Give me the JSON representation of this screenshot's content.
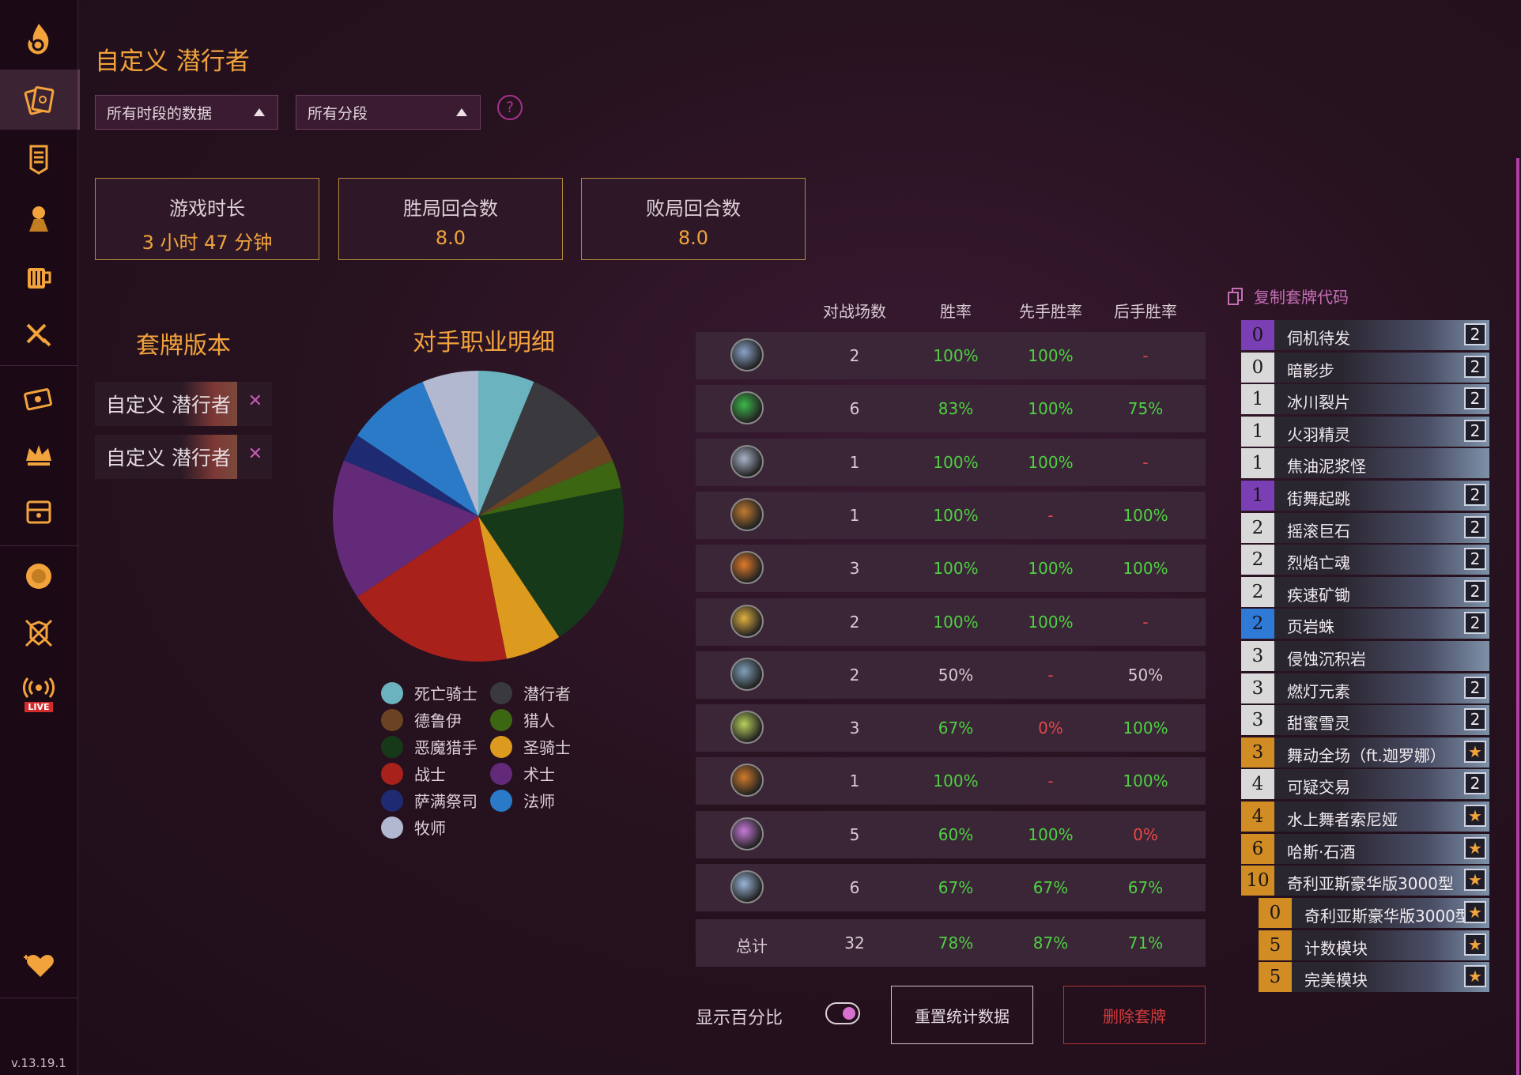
{
  "app": {
    "version": "v.13.19.1"
  },
  "rail": {
    "items": [
      {
        "name": "logo-flame-icon"
      },
      {
        "name": "decks-icon"
      },
      {
        "name": "battlegrounds-icon"
      },
      {
        "name": "mercenaries-icon"
      },
      {
        "name": "tavern-mug-icon"
      },
      {
        "name": "arena-icon"
      },
      {
        "name": "replays-icon"
      },
      {
        "name": "crown-icon"
      },
      {
        "name": "collection-icon"
      },
      {
        "name": "lion-icon"
      },
      {
        "name": "duels-icon"
      },
      {
        "name": "live-stream-icon"
      },
      {
        "name": "support-heart-icon"
      }
    ],
    "live_badge": "LIVE"
  },
  "header": {
    "title": "自定义 潜行者"
  },
  "filters": {
    "time_range": "所有时段的数据",
    "rank": "所有分段",
    "help": "?"
  },
  "stats": [
    {
      "label": "游戏时长",
      "value": "3 小时 47 分钟"
    },
    {
      "label": "胜局回合数",
      "value": "8.0"
    },
    {
      "label": "败局回合数",
      "value": "8.0"
    }
  ],
  "deck_versions": {
    "heading": "套牌版本",
    "items": [
      {
        "label": "自定义 潜行者",
        "close": "✕"
      },
      {
        "label": "自定义 潜行者",
        "close": "✕"
      }
    ]
  },
  "opponents": {
    "heading": "对手职业明细",
    "legend": [
      {
        "name": "死亡骑士",
        "color": "#6bb3be"
      },
      {
        "name": "潜行者",
        "color": "#3a3a3e"
      },
      {
        "name": "德鲁伊",
        "color": "#6b4322"
      },
      {
        "name": "猎人",
        "color": "#3d6612"
      },
      {
        "name": "恶魔猎手",
        "color": "#16391a"
      },
      {
        "name": "圣骑士",
        "color": "#dc9a1e"
      },
      {
        "name": "战士",
        "color": "#a8211a"
      },
      {
        "name": "术士",
        "color": "#622a78"
      },
      {
        "name": "萨满祭司",
        "color": "#1e2a72"
      },
      {
        "name": "法师",
        "color": "#2a7ac8"
      },
      {
        "name": "牧师",
        "color": "#b2b8d0"
      }
    ]
  },
  "chart_data": {
    "type": "pie",
    "labels": [
      "死亡骑士",
      "潜行者",
      "德鲁伊",
      "猎人",
      "恶魔猎手",
      "圣骑士",
      "战士",
      "术士",
      "萨满祭司",
      "法师",
      "牧师"
    ],
    "values": [
      2,
      3,
      1,
      1,
      6,
      2,
      6,
      5,
      1,
      3,
      2
    ],
    "colors": [
      "#6bb3be",
      "#3a3a3e",
      "#6b4322",
      "#3d6612",
      "#16391a",
      "#dc9a1e",
      "#a8211a",
      "#622a78",
      "#1e2a72",
      "#2a7ac8",
      "#b2b8d0"
    ],
    "legend_position": "bottom"
  },
  "table": {
    "headers": {
      "games": "对战场数",
      "winrate": "胜率",
      "first": "先手胜率",
      "second": "后手胜率"
    },
    "rows": [
      {
        "icon": "class-icon-1",
        "games": "2",
        "winrate": "100%",
        "first": "100%",
        "second": "-",
        "wr_c": "g",
        "f_c": "g",
        "s_c": "r"
      },
      {
        "icon": "class-icon-2",
        "games": "6",
        "winrate": "83%",
        "first": "100%",
        "second": "75%",
        "wr_c": "g",
        "f_c": "g",
        "s_c": "g"
      },
      {
        "icon": "class-icon-3",
        "games": "1",
        "winrate": "100%",
        "first": "100%",
        "second": "-",
        "wr_c": "g",
        "f_c": "g",
        "s_c": "r"
      },
      {
        "icon": "class-icon-4",
        "games": "1",
        "winrate": "100%",
        "first": "-",
        "second": "100%",
        "wr_c": "g",
        "f_c": "r",
        "s_c": "g"
      },
      {
        "icon": "class-icon-5",
        "games": "3",
        "winrate": "100%",
        "first": "100%",
        "second": "100%",
        "wr_c": "g",
        "f_c": "g",
        "s_c": "g"
      },
      {
        "icon": "class-icon-6",
        "games": "2",
        "winrate": "100%",
        "first": "100%",
        "second": "-",
        "wr_c": "g",
        "f_c": "g",
        "s_c": "r"
      },
      {
        "icon": "class-icon-7",
        "games": "2",
        "winrate": "50%",
        "first": "-",
        "second": "50%",
        "wr_c": "w",
        "f_c": "r",
        "s_c": "w"
      },
      {
        "icon": "class-icon-8",
        "games": "3",
        "winrate": "67%",
        "first": "0%",
        "second": "100%",
        "wr_c": "g",
        "f_c": "r",
        "s_c": "g"
      },
      {
        "icon": "class-icon-9",
        "games": "1",
        "winrate": "100%",
        "first": "-",
        "second": "100%",
        "wr_c": "g",
        "f_c": "r",
        "s_c": "g"
      },
      {
        "icon": "class-icon-10",
        "games": "5",
        "winrate": "60%",
        "first": "100%",
        "second": "0%",
        "wr_c": "g",
        "f_c": "g",
        "s_c": "r"
      },
      {
        "icon": "class-icon-11",
        "games": "6",
        "winrate": "67%",
        "first": "67%",
        "second": "67%",
        "wr_c": "g",
        "f_c": "g",
        "s_c": "g"
      }
    ],
    "total": {
      "label": "总计",
      "games": "32",
      "winrate": "78%",
      "first": "87%",
      "second": "71%"
    }
  },
  "controls": {
    "show_percent": "显示百分比",
    "reset": "重置统计数据",
    "delete": "删除套牌"
  },
  "deck": {
    "copy_code": "复制套牌代码",
    "cards": [
      {
        "cost": "0",
        "name": "伺机待发",
        "count": "2",
        "rarity": "epic"
      },
      {
        "cost": "0",
        "name": "暗影步",
        "count": "2",
        "rarity": "common"
      },
      {
        "cost": "1",
        "name": "冰川裂片",
        "count": "2",
        "rarity": "common"
      },
      {
        "cost": "1",
        "name": "火羽精灵",
        "count": "2",
        "rarity": "common"
      },
      {
        "cost": "1",
        "name": "焦油泥浆怪",
        "count": "",
        "rarity": "common"
      },
      {
        "cost": "1",
        "name": "街舞起跳",
        "count": "2",
        "rarity": "epic"
      },
      {
        "cost": "2",
        "name": "摇滚巨石",
        "count": "2",
        "rarity": "common"
      },
      {
        "cost": "2",
        "name": "烈焰亡魂",
        "count": "2",
        "rarity": "common"
      },
      {
        "cost": "2",
        "name": "疾速矿锄",
        "count": "2",
        "rarity": "common"
      },
      {
        "cost": "2",
        "name": "页岩蛛",
        "count": "2",
        "rarity": "rare"
      },
      {
        "cost": "3",
        "name": "侵蚀沉积岩",
        "count": "",
        "rarity": "common"
      },
      {
        "cost": "3",
        "name": "燃灯元素",
        "count": "2",
        "rarity": "common"
      },
      {
        "cost": "3",
        "name": "甜蜜雪灵",
        "count": "2",
        "rarity": "common"
      },
      {
        "cost": "3",
        "name": "舞动全场（ft.迦罗娜）",
        "count": "★",
        "rarity": "legendary"
      },
      {
        "cost": "4",
        "name": "可疑交易",
        "count": "2",
        "rarity": "common"
      },
      {
        "cost": "4",
        "name": "水上舞者索尼娅",
        "count": "★",
        "rarity": "legendary"
      },
      {
        "cost": "6",
        "name": "哈斯·石酒",
        "count": "★",
        "rarity": "legendary"
      },
      {
        "cost": "10",
        "name": "奇利亚斯豪华版3000型",
        "count": "★",
        "rarity": "legendary"
      }
    ],
    "subcards": [
      {
        "cost": "0",
        "name": "奇利亚斯豪华版3000型",
        "count": "★",
        "rarity": "legendary"
      },
      {
        "cost": "5",
        "name": "计数模块",
        "count": "★",
        "rarity": "legendary"
      },
      {
        "cost": "5",
        "name": "完美模块",
        "count": "★",
        "rarity": "legendary"
      }
    ]
  }
}
